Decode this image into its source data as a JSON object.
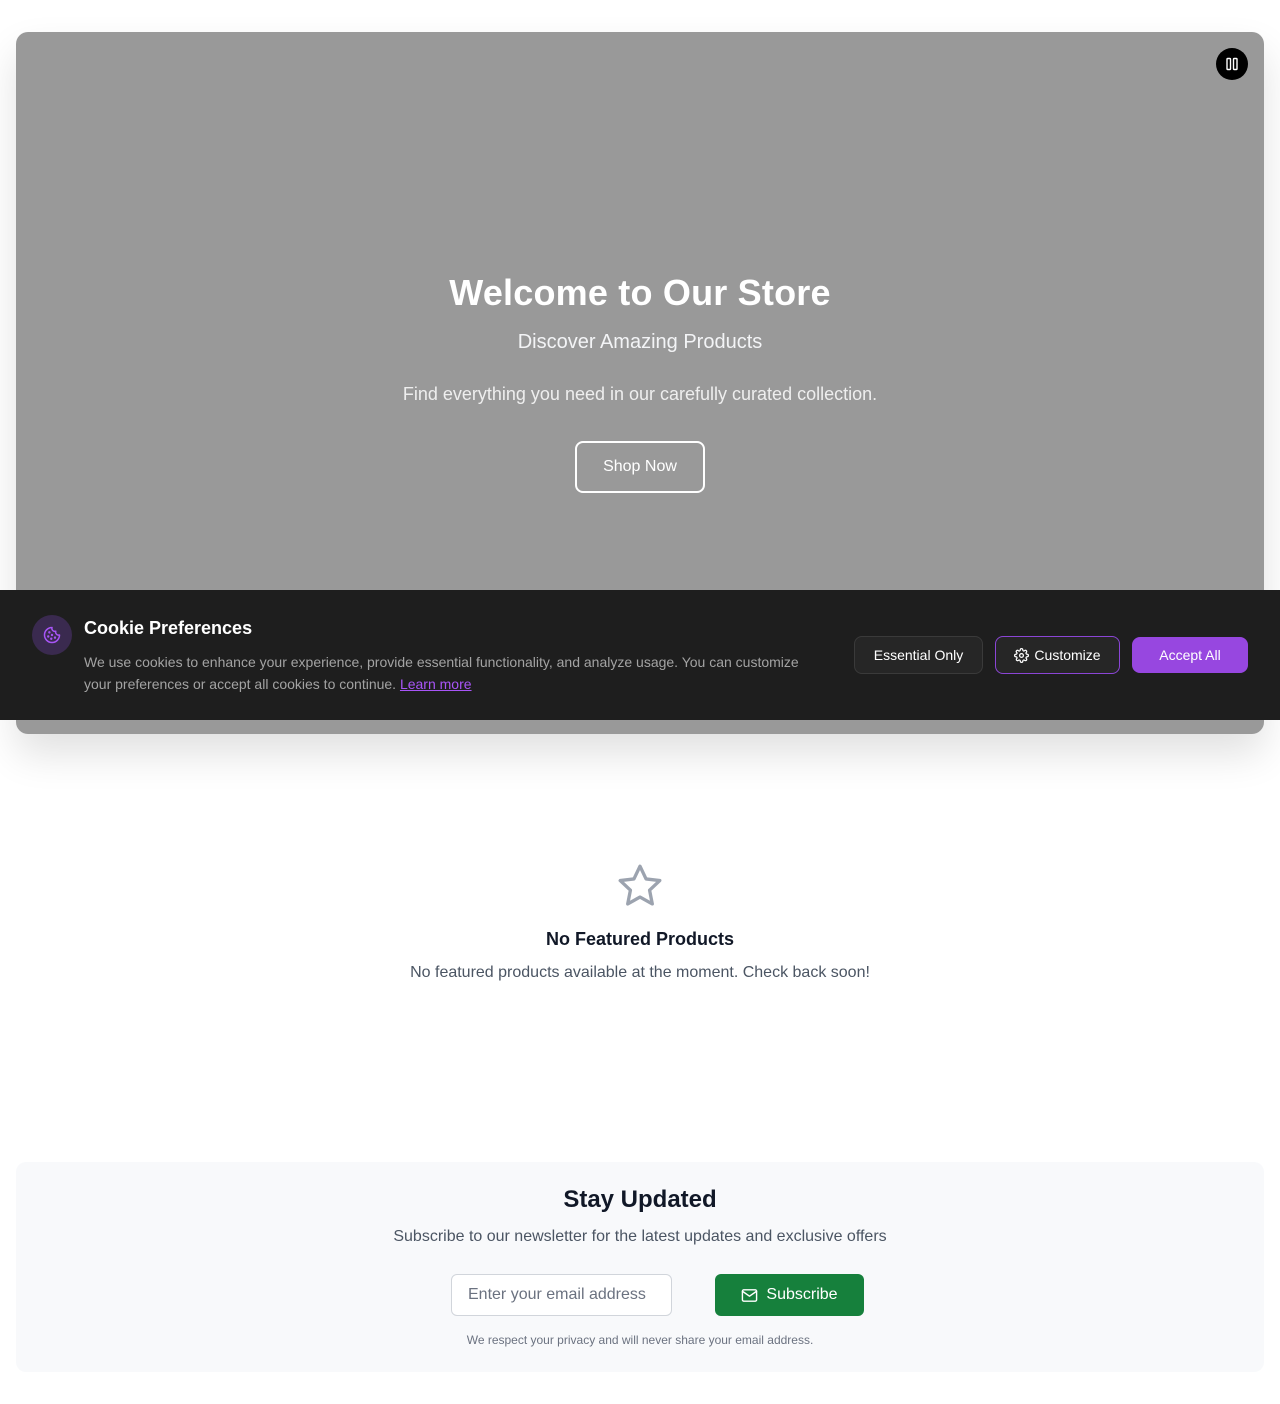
{
  "hero": {
    "title": "Welcome to Our Store",
    "subtitle": "Discover Amazing Products",
    "description": "Find everything you need in our carefully curated collection.",
    "cta_label": "Shop Now",
    "pause_icon": "pause-icon",
    "background_color": "#999999"
  },
  "cookie": {
    "icon": "cookie-icon",
    "title": "Cookie Preferences",
    "text": "We use cookies to enhance your experience, provide essential functionality, and analyze usage. You can customize your preferences or accept all cookies to continue.",
    "learn_more": "Learn more",
    "essential_label": "Essential Only",
    "customize_label": "Customize",
    "customize_icon": "gear-icon",
    "accept_label": "Accept All",
    "accent_color": "#9747e0"
  },
  "featured": {
    "icon": "star-icon",
    "title": "No Featured Products",
    "text": "No featured products available at the moment. Check back soon!"
  },
  "newsletter": {
    "title": "Stay Updated",
    "subtitle": "Subscribe to our newsletter for the latest updates and exclusive offers",
    "email_placeholder": "Enter your email address",
    "email_value": "",
    "subscribe_label": "Subscribe",
    "subscribe_icon": "mail-icon",
    "privacy_note": "We respect your privacy and will never share your email address.",
    "button_color": "#16803c"
  }
}
